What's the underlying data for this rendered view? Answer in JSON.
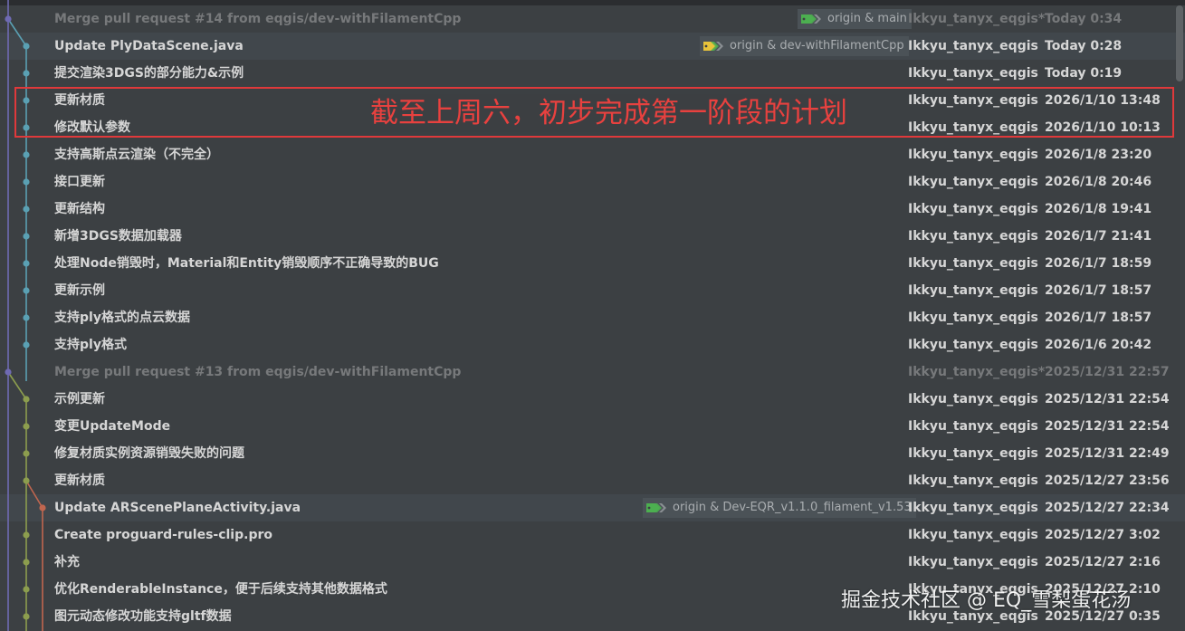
{
  "colors": {
    "branch_main": "#6f6ab3",
    "branch_blue": "#5aa0b3",
    "branch_olive": "#8c9d4e",
    "branch_orange": "#c0664f",
    "annotation": "#e0393b",
    "tag_green": "#4caf50",
    "tag_yellow": "#e8c33a"
  },
  "annotation": {
    "text": "截至上周六，初步完成第一阶段的计划"
  },
  "watermark": "掘金技术社区 @ EQ_雪梨蛋花汤",
  "commits": [
    {
      "message": "Merge pull request #14 from eqgis/dev-withFilamentCpp",
      "author": "Ikkyu_tanyx_eqgis*",
      "date": "Today 0:34",
      "merge": true,
      "ref": "origin & main",
      "ref_icon": "green"
    },
    {
      "message": "Update PlyDataScene.java",
      "author": "Ikkyu_tanyx_eqgis",
      "date": "Today 0:28",
      "ref": "origin & dev-withFilamentCpp",
      "ref_icon": "yellow"
    },
    {
      "message": "提交渲染3DGS的部分能力&示例",
      "author": "Ikkyu_tanyx_eqgis",
      "date": "Today 0:19"
    },
    {
      "message": "更新材质",
      "author": "Ikkyu_tanyx_eqgis",
      "date": "2026/1/10 13:48"
    },
    {
      "message": "修改默认参数",
      "author": "Ikkyu_tanyx_eqgis",
      "date": "2026/1/10 10:13"
    },
    {
      "message": "支持高斯点云渲染（不完全）",
      "author": "Ikkyu_tanyx_eqgis",
      "date": "2026/1/8 23:20"
    },
    {
      "message": "接口更新",
      "author": "Ikkyu_tanyx_eqgis",
      "date": "2026/1/8 20:46"
    },
    {
      "message": "更新结构",
      "author": "Ikkyu_tanyx_eqgis",
      "date": "2026/1/8 19:41"
    },
    {
      "message": "新增3DGS数据加载器",
      "author": "Ikkyu_tanyx_eqgis",
      "date": "2026/1/7 21:41"
    },
    {
      "message": "处理Node销毁时，Material和Entity销毁顺序不正确导致的BUG",
      "author": "Ikkyu_tanyx_eqgis",
      "date": "2026/1/7 18:59"
    },
    {
      "message": "更新示例",
      "author": "Ikkyu_tanyx_eqgis",
      "date": "2026/1/7 18:57"
    },
    {
      "message": "支持ply格式的点云数据",
      "author": "Ikkyu_tanyx_eqgis",
      "date": "2026/1/7 18:57"
    },
    {
      "message": "支持ply格式",
      "author": "Ikkyu_tanyx_eqgis",
      "date": "2026/1/6 20:42"
    },
    {
      "message": "Merge pull request #13 from eqgis/dev-withFilamentCpp",
      "author": "Ikkyu_tanyx_eqgis*",
      "date": "2025/12/31 22:57",
      "merge": true
    },
    {
      "message": "示例更新",
      "author": "Ikkyu_tanyx_eqgis",
      "date": "2025/12/31 22:54"
    },
    {
      "message": "变更UpdateMode",
      "author": "Ikkyu_tanyx_eqgis",
      "date": "2025/12/31 22:54"
    },
    {
      "message": "修复材质实例资源销毁失败的问题",
      "author": "Ikkyu_tanyx_eqgis",
      "date": "2025/12/31 22:49"
    },
    {
      "message": "更新材质",
      "author": "Ikkyu_tanyx_eqgis",
      "date": "2025/12/27 23:56"
    },
    {
      "message": "Update ARScenePlaneActivity.java",
      "author": "Ikkyu_tanyx_eqgis",
      "date": "2025/12/27 22:34",
      "ref": "origin & Dev-EQR_v1.1.0_filament_v1.53",
      "ref_icon": "green"
    },
    {
      "message": "Create proguard-rules-clip.pro",
      "author": "Ikkyu_tanyx_eqgis",
      "date": "2025/12/27 3:02"
    },
    {
      "message": "补充",
      "author": "Ikkyu_tanyx_eqgis",
      "date": "2025/12/27 2:16"
    },
    {
      "message": "优化RenderableInstance，便于后续支持其他数据格式",
      "author": "Ikkyu_tanyx_eqgis",
      "date": "2025/12/27 2:10"
    },
    {
      "message": "图元动态修改功能支持gltf数据",
      "author": "Ikkyu_tanyx_eqgis",
      "date": "2025/12/27 0:35"
    }
  ]
}
